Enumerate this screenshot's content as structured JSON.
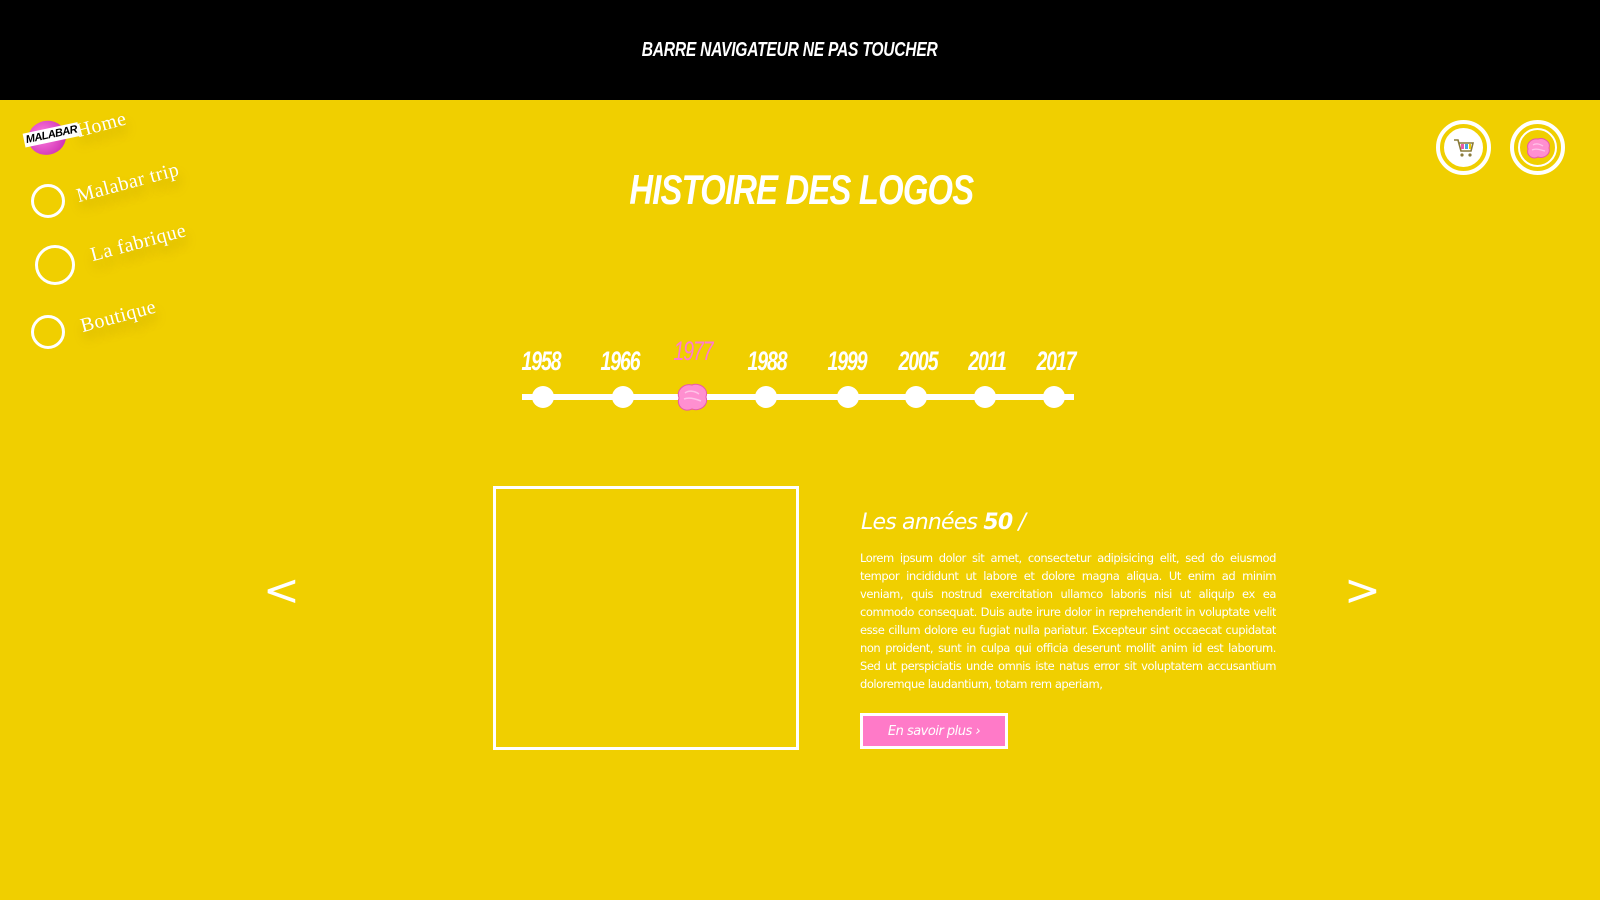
{
  "topbar": {
    "text": "BARRE NAVIGATEUR NE PAS TOUCHER"
  },
  "logo": {
    "text": "MALABAR"
  },
  "nav": {
    "items": [
      {
        "label": "Home",
        "icon": "malabar-logo-icon"
      },
      {
        "label": "Malabar trip",
        "icon": "circle-icon"
      },
      {
        "label": "La fabrique",
        "icon": "circle-icon"
      },
      {
        "label": "Boutique",
        "icon": "circle-icon"
      }
    ]
  },
  "header_buttons": {
    "cart_icon": "shopping-cart-icon",
    "gum_icon": "bubble-gum-icon"
  },
  "page": {
    "title": "HISTOIRE DES LOGOS"
  },
  "timeline": {
    "years": [
      "1958",
      "1966",
      "1977",
      "1988",
      "1999",
      "2005",
      "2011",
      "2017"
    ],
    "active_year": "1977"
  },
  "carousel": {
    "prev_label": "<",
    "next_label": ">"
  },
  "content": {
    "heading_prefix": "Les années ",
    "heading_number": "50",
    "heading_suffix": " /",
    "body": "Lorem ipsum dolor sit amet, consectetur adipisicing elit, sed do eiusmod tempor incididunt ut labore et dolore magna aliqua. Ut enim ad minim veniam, quis nostrud exercitation ullamco laboris nisi ut aliquip ex ea commodo consequat. Duis aute irure dolor in reprehenderit in voluptate velit esse cillum dolore eu fugiat nulla pariatur. Excepteur sint occaecat cupidatat non proident, sunt in culpa qui officia deserunt mollit anim id est laborum. Sed ut perspiciatis unde omnis iste natus error sit voluptatem accusantium doloremque laudantium, totam rem aperiam,",
    "more_button": "En savoir plus ›"
  },
  "colors": {
    "background": "#f0cf00",
    "topbar": "#000000",
    "accent_pink": "#ff7ac8",
    "text": "#ffffff"
  }
}
